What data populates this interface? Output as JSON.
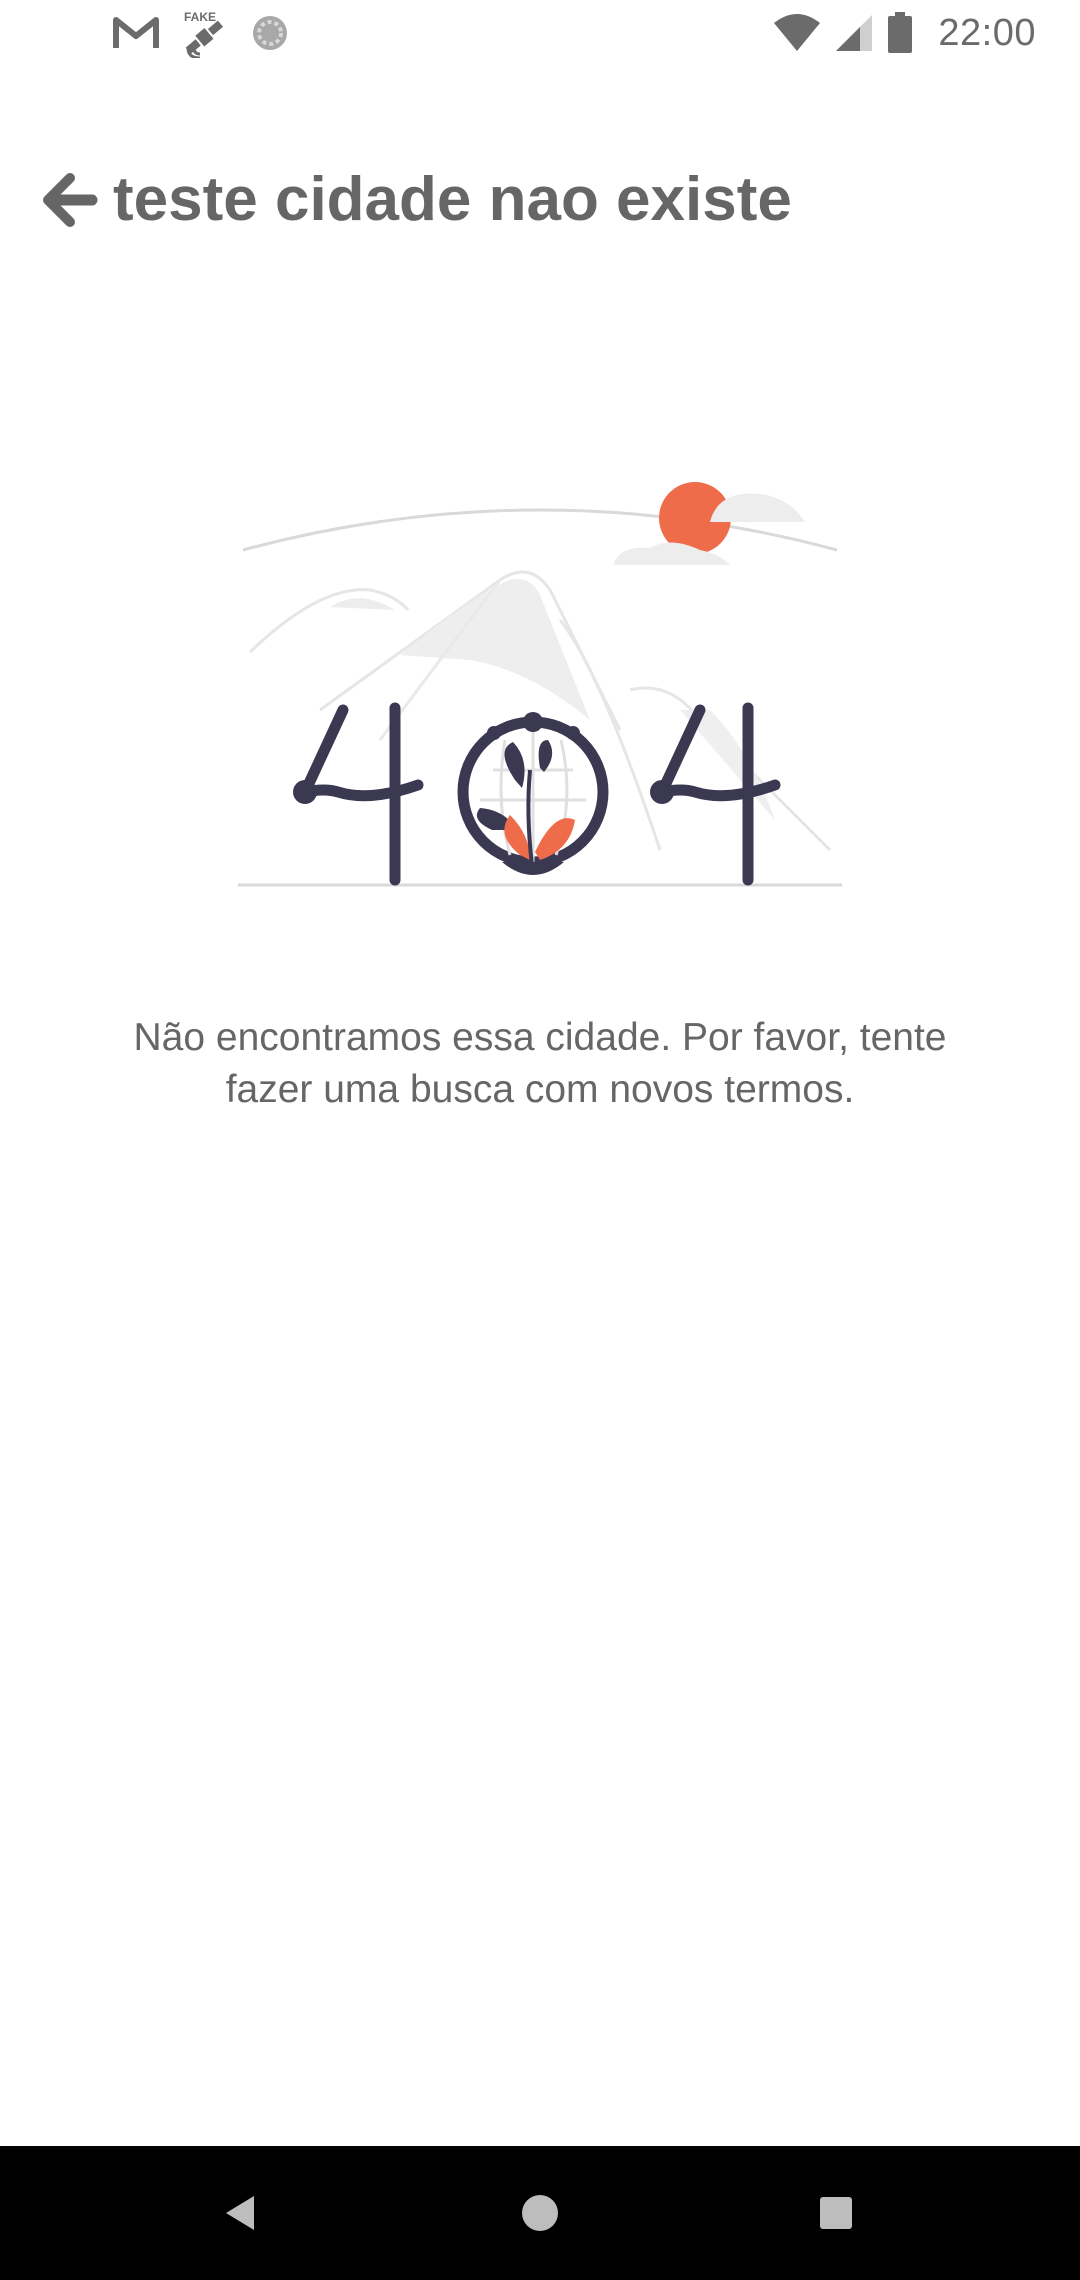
{
  "status_bar": {
    "time": "22:00",
    "icons": [
      "gmail-icon",
      "fake-gps-icon",
      "sync-icon",
      "wifi-icon",
      "signal-icon",
      "battery-icon"
    ]
  },
  "header": {
    "title": "teste cidade nao existe",
    "back_icon": "arrow-left-icon"
  },
  "illustration": {
    "label": "404",
    "accent_color": "#ef6c4a",
    "ink_color": "#3b3851"
  },
  "message": {
    "line1": "Não encontramos essa cidade. Por favor, tente",
    "line2": "fazer uma busca com novos termos."
  },
  "nav_bar": {
    "buttons": [
      "back-icon",
      "home-icon",
      "recents-icon"
    ]
  }
}
